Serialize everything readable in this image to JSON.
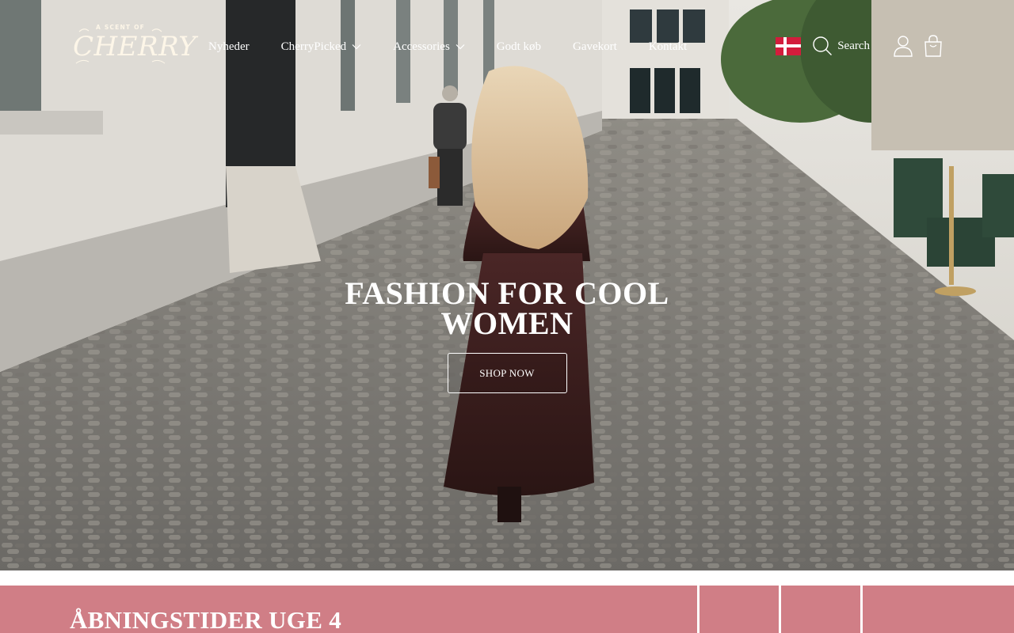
{
  "brand": {
    "logo_small": "A SCENT OF",
    "logo_big": "CHERRY"
  },
  "nav": {
    "items": [
      {
        "label": "Nyheder",
        "has_dropdown": false
      },
      {
        "label": "CherryPicked",
        "has_dropdown": true
      },
      {
        "label": "Accessories",
        "has_dropdown": true
      },
      {
        "label": "Godt køb",
        "has_dropdown": false
      },
      {
        "label": "Gavekort",
        "has_dropdown": false
      },
      {
        "label": "Kontakt",
        "has_dropdown": false
      }
    ]
  },
  "utilities": {
    "language_flag": "denmark-flag-icon",
    "search_label": "Search",
    "account_icon": "user-icon",
    "cart_icon": "shopping-bag-icon"
  },
  "hero": {
    "title": "FASHION FOR COOL WOMEN",
    "button_label": "SHOP NOW"
  },
  "band": {
    "title": "ÅBNINGSTIDER UGE 4"
  },
  "colors": {
    "accent_pink": "#d07e86",
    "flag_red": "#d31d3c",
    "text_light": "#ffffff",
    "logo_cream": "#fdf6e8"
  }
}
